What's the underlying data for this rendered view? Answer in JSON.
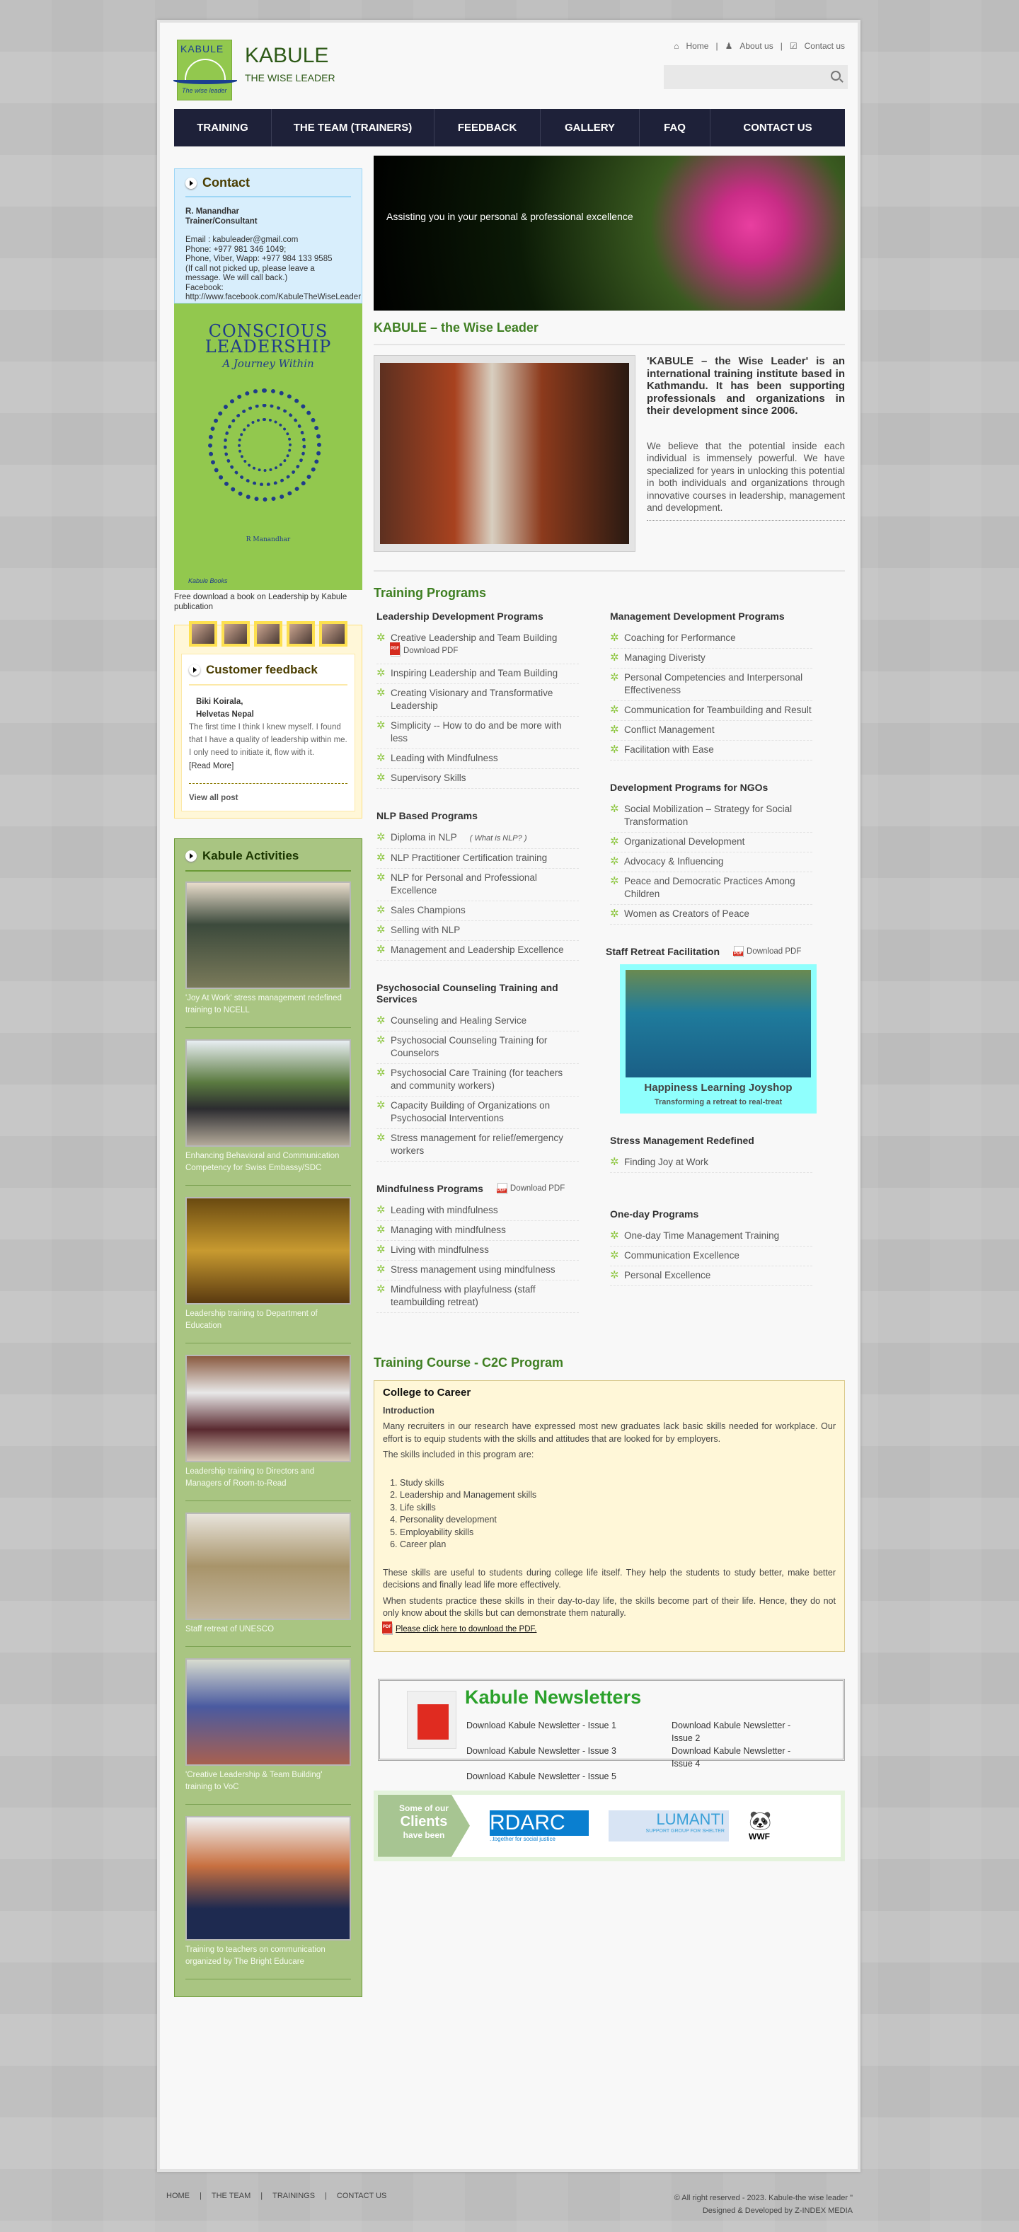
{
  "header": {
    "logo_text": "KABULE",
    "logo_sub": "The wise leader",
    "brand": "KABULE",
    "tagline": "THE WISE LEADER",
    "top_links": [
      "Home",
      "About us",
      "Contact us"
    ],
    "search_placeholder": ""
  },
  "nav": [
    "TRAINING",
    "THE TEAM (TRAINERS)",
    "FEEDBACK",
    "GALLERY",
    "FAQ",
    "CONTACT US"
  ],
  "contact": {
    "title": "Contact",
    "name": "R. Manandhar",
    "role": "Trainer/Consultant",
    "lines": [
      "Email : kabuleader@gmail.com",
      "Phone: +977 981 346 1049;",
      "Phone, Viber, Wapp: +977 984 133 9585",
      "(If call not picked up, please leave a",
      "message. We will call back.)",
      "Facebook:",
      "http://www.facebook.com/KabuleTheWiseLeader"
    ]
  },
  "book": {
    "title1": "CONSCIOUS",
    "title2": "LEADERSHIP",
    "subtitle": "A Journey Within",
    "author": "R Manandhar",
    "publisher": "Kabule Books",
    "caption": "Free download a book on Leadership by Kabule publication"
  },
  "feedback": {
    "title": "Customer feedback",
    "name": "Biki Koirala,",
    "org": "Helvetas Nepal",
    "quote": "The first time I think I knew myself. I found that I have a quality of leadership within me. I only need to initiate it, flow with it.",
    "read_more": "[Read More]",
    "view_all": "View all post"
  },
  "activities": {
    "title": "Kabule Activities",
    "items": [
      "'Joy At Work' stress management redefined training to NCELL",
      "Enhancing Behavioral and Communication Competency for Swiss Embassy/SDC",
      "Leadership training to Department of Education",
      "Leadership training to Directors and Managers of Room-to-Read",
      "Staff retreat of UNESCO",
      "'Creative Leadership & Team Building' training to VoC",
      "Training to teachers on communication organized by The Bright Educare"
    ]
  },
  "banner": "Assisting you in your personal & professional excellence",
  "about": {
    "heading": "KABULE – the Wise Leader",
    "bold": "'KABULE – the Wise Leader' is an international training institute based in Kathmandu. It has been supporting professionals and organizations in their development since 2006.",
    "text": "We believe that the potential inside each individual is immensely powerful. We have specialized for years in unlocking this potential in both individuals and organizations through innovative courses in leadership, management and development."
  },
  "training": {
    "heading": "Training Programs",
    "download_pdf": "Download PDF",
    "what_is_nlp": "( What is NLP? )",
    "left": [
      {
        "title": "Leadership Development Programs",
        "items": [
          "Creative Leadership and Team Building",
          "Inspiring Leadership and Team Building",
          "Creating Visionary and Transformative Leadership",
          "Simplicity -- How to do and be more with less",
          "Leading with Mindfulness",
          "Supervisory Skills"
        ]
      },
      {
        "title": "NLP Based Programs",
        "items": [
          "Diploma in NLP",
          "NLP Practitioner Certification training",
          "NLP for Personal and Professional Excellence",
          "Sales Champions",
          "Selling with NLP",
          "Management and Leadership Excellence"
        ]
      },
      {
        "title": "Psychosocial Counseling Training and Services",
        "items": [
          "Counseling and Healing Service",
          "Psychosocial Counseling Training for Counselors",
          "Psychosocial Care Training (for teachers and community workers)",
          "Capacity Building of Organizations on Psychosocial Interventions",
          "Stress management for relief/emergency workers"
        ]
      },
      {
        "title": "Mindfulness Programs",
        "items": [
          "Leading with mindfulness",
          "Managing with mindfulness",
          "Living with mindfulness",
          "Stress management using mindfulness",
          "Mindfulness with playfulness (staff teambuilding retreat)"
        ]
      }
    ],
    "right": [
      {
        "title": "Management Development Programs",
        "items": [
          "Coaching for Performance",
          "Managing Diveristy",
          "Personal Competencies and Interpersonal Effectiveness",
          "Communication for Teambuilding and Result",
          "Conflict Management",
          "Facilitation with Ease"
        ]
      },
      {
        "title": "Development Programs for NGOs",
        "items": [
          "Social Mobilization – Strategy for Social Transformation",
          "Organizational Development",
          "Advocacy & Influencing",
          "Peace and Democratic Practices Among Children",
          "Women as Creators of Peace"
        ]
      },
      {
        "title": "Staff Retreat Facilitation",
        "items": []
      },
      {
        "title": "Stress Management Redefined",
        "items": [
          "Finding Joy at Work"
        ]
      },
      {
        "title": "One-day Programs",
        "items": [
          "One-day Time Management Training",
          "Communication Excellence",
          "Personal Excellence"
        ]
      }
    ],
    "joyshop": {
      "title": "Happiness Learning Joyshop",
      "subtitle": "Transforming a retreat to real-treat"
    }
  },
  "c2c": {
    "heading": "Training Course - C2C Program",
    "title": "College to Career",
    "intro_label": "Introduction",
    "p1": "Many recruiters in our research have expressed most new graduates lack basic skills needed for workplace. Our effort is to equip students with the skills and attitudes that are looked for by employers.",
    "p2": "The skills included in this program are:",
    "skills": [
      "Study skills",
      "Leadership and Management skills",
      "Life skills",
      "Personality development",
      "Employability skills",
      "Career plan"
    ],
    "p3": "These skills are useful to students during college life itself. They help the students to study better, make better decisions and finally lead life more effectively.",
    "p4": "When students practice these skills in their day-to-day life, the skills become part of their life. Hence, they do not only know about the skills but can demonstrate them naturally.",
    "pdf_link": "Please click here to download the PDF."
  },
  "newsletters": {
    "title": "Kabule Newsletters",
    "links": [
      "Download Kabule Newsletter - Issue 1",
      "Download Kabule Newsletter - Issue 2",
      "Download Kabule Newsletter - Issue 3",
      "Download Kabule Newsletter - Issue 4",
      "Download Kabule Newsletter - Issue 5"
    ]
  },
  "clients": {
    "l1": "Some of our",
    "l2": "Clients",
    "l3": "have been",
    "logos": [
      "RDARC",
      "..together for social justice",
      "LUMANTI",
      "SUPPORT GROUP FOR SHELTER",
      "WWF"
    ]
  },
  "footer": {
    "links": [
      "HOME",
      "THE TEAM",
      "TRAININGS",
      "CONTACT US"
    ],
    "copyright": "© All right reserved - 2023. Kabule-the wise leader \"",
    "credit": "Designed & Developed by Z-INDEX MEDIA"
  }
}
